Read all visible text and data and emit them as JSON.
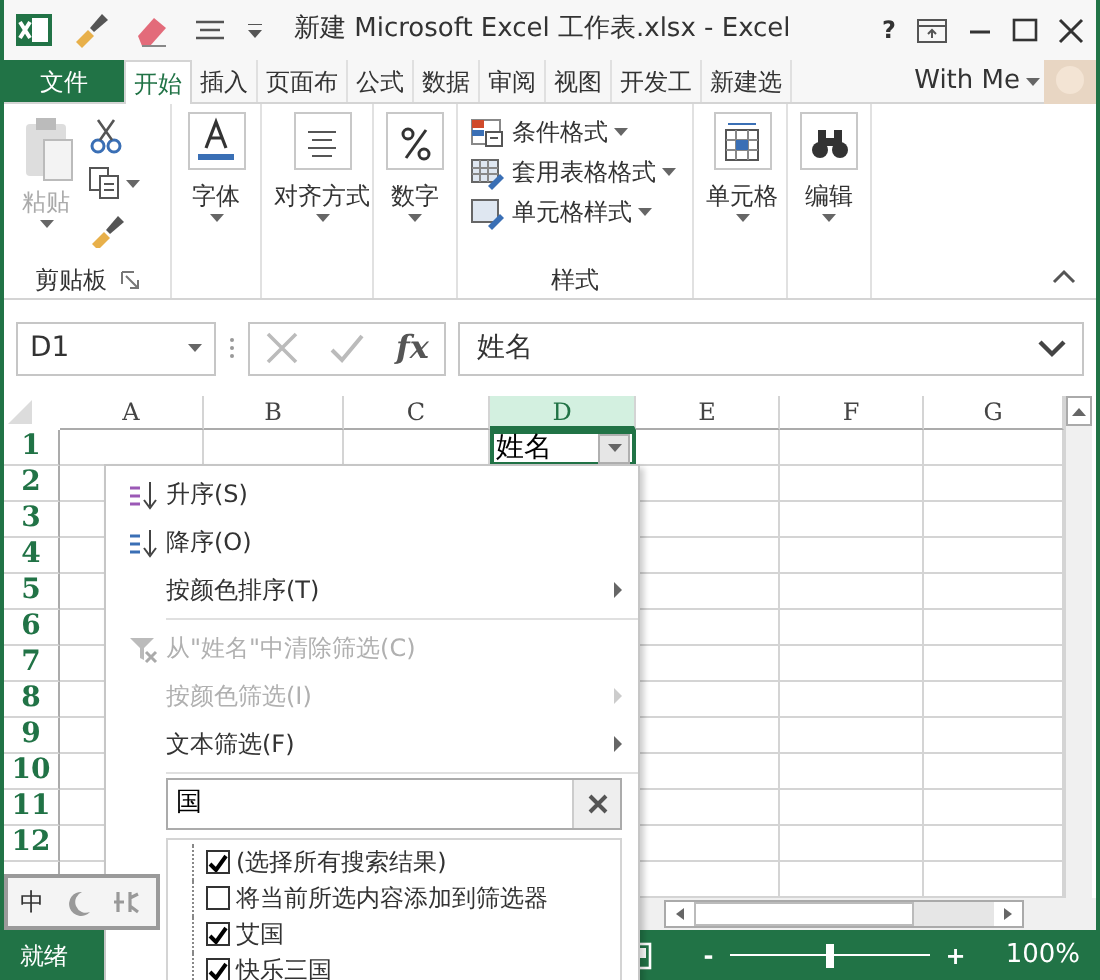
{
  "window": {
    "title": "新建 Microsoft Excel 工作表.xlsx - Excel",
    "help": "?"
  },
  "ribbon_tabs": [
    {
      "label": "文件",
      "kind": "file",
      "selected": false
    },
    {
      "label": "开始",
      "kind": "tab",
      "selected": true
    },
    {
      "label": "插入",
      "kind": "tab",
      "selected": false
    },
    {
      "label": "页面布",
      "kind": "tab",
      "selected": false
    },
    {
      "label": "公式",
      "kind": "tab",
      "selected": false
    },
    {
      "label": "数据",
      "kind": "tab",
      "selected": false
    },
    {
      "label": "审阅",
      "kind": "tab",
      "selected": false
    },
    {
      "label": "视图",
      "kind": "tab",
      "selected": false
    },
    {
      "label": "开发工",
      "kind": "tab",
      "selected": false
    },
    {
      "label": "新建选",
      "kind": "tab",
      "selected": false
    }
  ],
  "account": {
    "label": "With Me"
  },
  "ribbon_groups": [
    {
      "kind": "clipboard",
      "label": "剪贴板",
      "buttons": [
        {
          "label": "粘贴",
          "disabled": true
        }
      ]
    },
    {
      "kind": "single",
      "buttons": [
        {
          "label": "字体",
          "kind": "font"
        }
      ]
    },
    {
      "kind": "single",
      "buttons": [
        {
          "label": "对齐方式",
          "kind": "align"
        }
      ]
    },
    {
      "kind": "single",
      "buttons": [
        {
          "label": "数字",
          "kind": "number"
        }
      ]
    },
    {
      "kind": "list",
      "label": "样式",
      "buttons": [
        {
          "label": "条件格式",
          "kind": "conditional"
        },
        {
          "label": "套用表格格式",
          "kind": "table"
        },
        {
          "label": "单元格样式",
          "kind": "style"
        }
      ]
    },
    {
      "kind": "single",
      "buttons": [
        {
          "label": "单元格",
          "kind": "cells"
        }
      ]
    },
    {
      "kind": "single",
      "buttons": [
        {
          "label": "编辑",
          "kind": "find"
        }
      ]
    }
  ],
  "formula_bar": {
    "name_box": "D1",
    "fx": "fx",
    "formula": "姓名"
  },
  "sheet": {
    "columns": [
      {
        "label": "A",
        "selected": false
      },
      {
        "label": "B",
        "selected": false
      },
      {
        "label": "C",
        "selected": false
      },
      {
        "label": "D",
        "selected": true
      },
      {
        "label": "E",
        "selected": false
      },
      {
        "label": "F",
        "selected": false
      },
      {
        "label": "G",
        "selected": false
      }
    ],
    "rows": [
      "1",
      "2",
      "3",
      "4",
      "5",
      "6",
      "7",
      "8",
      "9",
      "10",
      "11",
      "12"
    ],
    "active_cell": {
      "text": "姓名",
      "filter": true
    }
  },
  "filter_menu": {
    "items": [
      {
        "kind": "command",
        "label": "升序(S)",
        "disabled": false,
        "submenu": false
      },
      {
        "kind": "command",
        "label": "降序(O)",
        "disabled": false,
        "submenu": false
      },
      {
        "kind": "command",
        "label": "按颜色排序(T)",
        "disabled": false,
        "submenu": true
      },
      {
        "kind": "separator"
      },
      {
        "kind": "command",
        "label": "从\"姓名\"中清除筛选(C)",
        "disabled": true,
        "submenu": false
      },
      {
        "kind": "command",
        "label": "按颜色筛选(I)",
        "disabled": true,
        "submenu": true
      },
      {
        "kind": "command",
        "label": "文本筛选(F)",
        "disabled": false,
        "submenu": true
      },
      {
        "kind": "separator"
      }
    ],
    "search": {
      "value": "国"
    },
    "values": [
      {
        "label": "(选择所有搜索结果)",
        "checked": true
      },
      {
        "label": "将当前所选内容添加到筛选器",
        "checked": false
      },
      {
        "label": "艾国",
        "checked": true
      },
      {
        "label": "快乐三国",
        "checked": true
      }
    ]
  },
  "ime_bar": {
    "label": "中"
  },
  "status_bar": {
    "text": "就绪",
    "zoom_out": "-",
    "zoom_in": "+",
    "zoom": "100%",
    "level": 0.5
  }
}
